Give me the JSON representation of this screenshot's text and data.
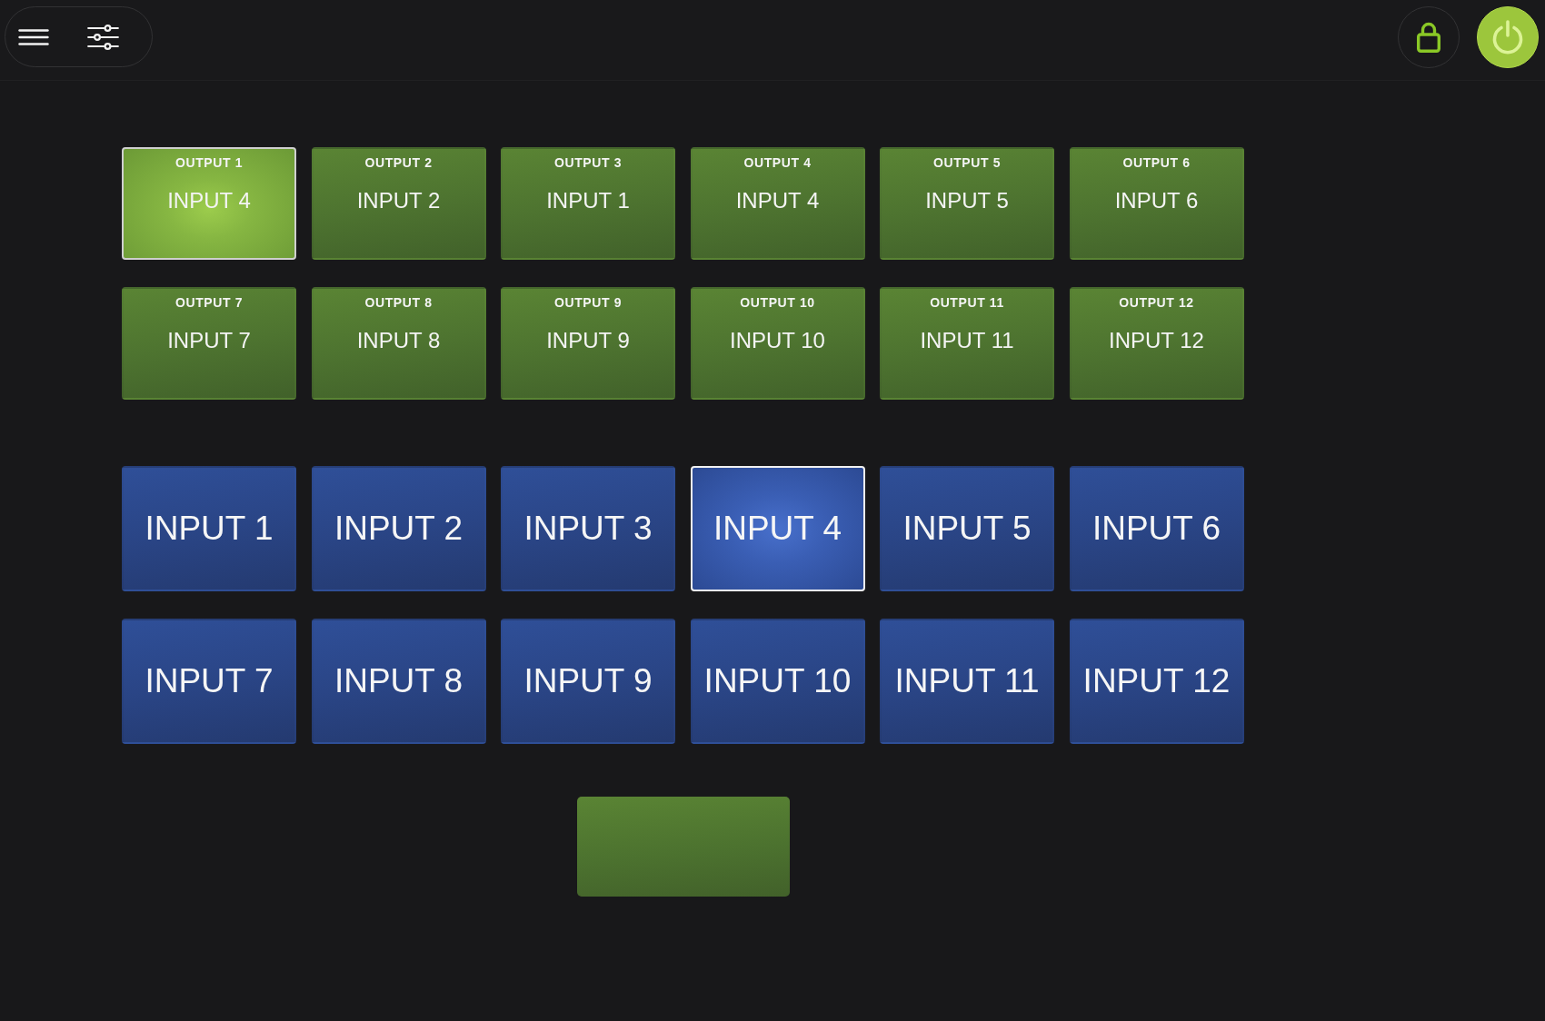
{
  "header": {
    "lock": {
      "locked": true
    },
    "power": {
      "on": true
    }
  },
  "outputs": [
    {
      "label": "OUTPUT 1",
      "route": "INPUT 4",
      "selected": true
    },
    {
      "label": "OUTPUT 2",
      "route": "INPUT 2",
      "selected": false
    },
    {
      "label": "OUTPUT 3",
      "route": "INPUT 1",
      "selected": false
    },
    {
      "label": "OUTPUT 4",
      "route": "INPUT 4",
      "selected": false
    },
    {
      "label": "OUTPUT 5",
      "route": "INPUT 5",
      "selected": false
    },
    {
      "label": "OUTPUT 6",
      "route": "INPUT 6",
      "selected": false
    },
    {
      "label": "OUTPUT 7",
      "route": "INPUT 7",
      "selected": false
    },
    {
      "label": "OUTPUT 8",
      "route": "INPUT 8",
      "selected": false
    },
    {
      "label": "OUTPUT 9",
      "route": "INPUT 9",
      "selected": false
    },
    {
      "label": "OUTPUT 10",
      "route": "INPUT 10",
      "selected": false
    },
    {
      "label": "OUTPUT 11",
      "route": "INPUT 11",
      "selected": false
    },
    {
      "label": "OUTPUT 12",
      "route": "INPUT 12",
      "selected": false
    }
  ],
  "inputs": [
    {
      "label": "INPUT 1",
      "selected": false
    },
    {
      "label": "INPUT 2",
      "selected": false
    },
    {
      "label": "INPUT 3",
      "selected": false
    },
    {
      "label": "INPUT 4",
      "selected": true
    },
    {
      "label": "INPUT 5",
      "selected": false
    },
    {
      "label": "INPUT 6",
      "selected": false
    },
    {
      "label": "INPUT 7",
      "selected": false
    },
    {
      "label": "INPUT 8",
      "selected": false
    },
    {
      "label": "INPUT 9",
      "selected": false
    },
    {
      "label": "INPUT 10",
      "selected": false
    },
    {
      "label": "INPUT 11",
      "selected": false
    },
    {
      "label": "INPUT 12",
      "selected": false
    }
  ]
}
